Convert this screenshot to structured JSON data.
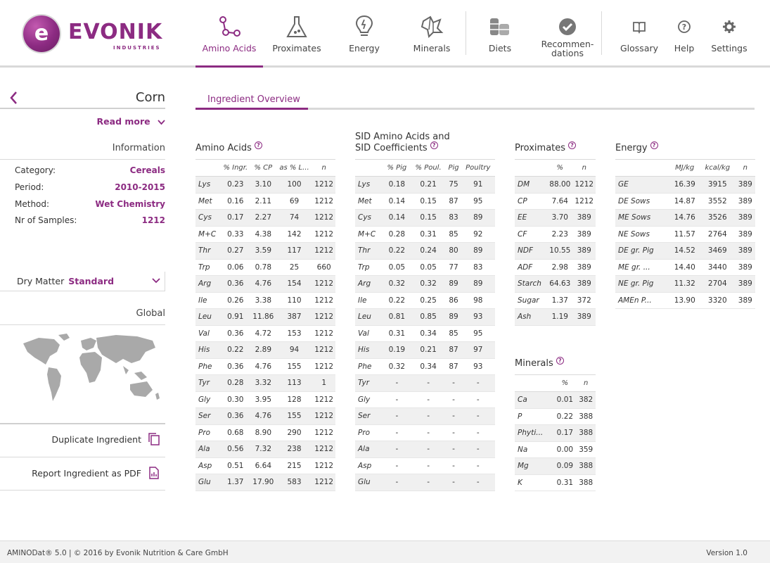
{
  "brand": {
    "name": "EVONIK",
    "sub": "INDUSTRIES"
  },
  "nav": [
    {
      "label": "Amino Acids",
      "icon": "molecule-icon",
      "active": true
    },
    {
      "label": "Proximates",
      "icon": "flask-icon"
    },
    {
      "label": "Energy",
      "icon": "lightbulb-icon"
    },
    {
      "label": "Minerals",
      "icon": "mineral-icon"
    },
    {
      "label": "Diets",
      "icon": "diets-icon"
    },
    {
      "label": "Recommen-\ndations",
      "icon": "check-badge-icon"
    },
    {
      "label": "Glossary",
      "icon": "book-icon"
    },
    {
      "label": "Help",
      "icon": "help-icon"
    },
    {
      "label": "Settings",
      "icon": "gear-icon"
    }
  ],
  "ingredient": {
    "name": "Corn",
    "read_more": "Read more",
    "information_label": "Information",
    "info": [
      {
        "key": "Category:",
        "value": "Cereals"
      },
      {
        "key": "Period:",
        "value": "2010-2015"
      },
      {
        "key": "Method:",
        "value": "Wet Chemistry"
      },
      {
        "key": "Nr of Samples:",
        "value": "1212"
      }
    ],
    "dry_matter_label": "Dry Matter",
    "dry_matter_value": "Standard",
    "global_label": "Global",
    "duplicate_label": "Duplicate Ingredient",
    "report_label": "Report Ingredient as PDF"
  },
  "tab": "Ingredient Overview",
  "amino_acids": {
    "title": "Amino Acids",
    "columns": [
      "",
      "% Ingr.",
      "% CP",
      "as % L...",
      "n"
    ],
    "rows": [
      [
        "Lys",
        "0.23",
        "3.10",
        "100",
        "1212"
      ],
      [
        "Met",
        "0.16",
        "2.11",
        "69",
        "1212"
      ],
      [
        "Cys",
        "0.17",
        "2.27",
        "74",
        "1212"
      ],
      [
        "M+C",
        "0.33",
        "4.38",
        "142",
        "1212"
      ],
      [
        "Thr",
        "0.27",
        "3.59",
        "117",
        "1212"
      ],
      [
        "Trp",
        "0.06",
        "0.78",
        "25",
        "660"
      ],
      [
        "Arg",
        "0.36",
        "4.76",
        "154",
        "1212"
      ],
      [
        "Ile",
        "0.26",
        "3.38",
        "110",
        "1212"
      ],
      [
        "Leu",
        "0.91",
        "11.86",
        "387",
        "1212"
      ],
      [
        "Val",
        "0.36",
        "4.72",
        "153",
        "1212"
      ],
      [
        "His",
        "0.22",
        "2.89",
        "94",
        "1212"
      ],
      [
        "Phe",
        "0.36",
        "4.76",
        "155",
        "1212"
      ],
      [
        "Tyr",
        "0.28",
        "3.32",
        "113",
        "1"
      ],
      [
        "Gly",
        "0.30",
        "3.95",
        "128",
        "1212"
      ],
      [
        "Ser",
        "0.36",
        "4.76",
        "155",
        "1212"
      ],
      [
        "Pro",
        "0.68",
        "8.90",
        "290",
        "1212"
      ],
      [
        "Ala",
        "0.56",
        "7.32",
        "238",
        "1212"
      ],
      [
        "Asp",
        "0.51",
        "6.64",
        "215",
        "1212"
      ],
      [
        "Glu",
        "1.37",
        "17.90",
        "583",
        "1212"
      ]
    ]
  },
  "sid": {
    "title_line1": "SID Amino Acids and",
    "title_line2": "SID Coefficients",
    "columns": [
      "",
      "% Pig",
      "% Poul.",
      "Pig",
      "Poultry"
    ],
    "rows": [
      [
        "Lys",
        "0.18",
        "0.21",
        "75",
        "91"
      ],
      [
        "Met",
        "0.14",
        "0.15",
        "87",
        "95"
      ],
      [
        "Cys",
        "0.14",
        "0.15",
        "83",
        "89"
      ],
      [
        "M+C",
        "0.28",
        "0.31",
        "85",
        "92"
      ],
      [
        "Thr",
        "0.22",
        "0.24",
        "80",
        "89"
      ],
      [
        "Trp",
        "0.05",
        "0.05",
        "77",
        "83"
      ],
      [
        "Arg",
        "0.32",
        "0.32",
        "89",
        "89"
      ],
      [
        "Ile",
        "0.22",
        "0.25",
        "86",
        "98"
      ],
      [
        "Leu",
        "0.81",
        "0.85",
        "89",
        "93"
      ],
      [
        "Val",
        "0.31",
        "0.34",
        "85",
        "95"
      ],
      [
        "His",
        "0.19",
        "0.21",
        "87",
        "97"
      ],
      [
        "Phe",
        "0.32",
        "0.34",
        "87",
        "93"
      ],
      [
        "Tyr",
        "-",
        "-",
        "-",
        "-"
      ],
      [
        "Gly",
        "-",
        "-",
        "-",
        "-"
      ],
      [
        "Ser",
        "-",
        "-",
        "-",
        "-"
      ],
      [
        "Pro",
        "-",
        "-",
        "-",
        "-"
      ],
      [
        "Ala",
        "-",
        "-",
        "-",
        "-"
      ],
      [
        "Asp",
        "-",
        "-",
        "-",
        "-"
      ],
      [
        "Glu",
        "-",
        "-",
        "-",
        "-"
      ]
    ]
  },
  "proximates": {
    "title": "Proximates",
    "columns": [
      "",
      "%",
      "n"
    ],
    "rows": [
      [
        "DM",
        "88.00",
        "1212"
      ],
      [
        "CP",
        "7.64",
        "1212"
      ],
      [
        "EE",
        "3.70",
        "389"
      ],
      [
        "CF",
        "2.23",
        "389"
      ],
      [
        "NDF",
        "10.55",
        "389"
      ],
      [
        "ADF",
        "2.98",
        "389"
      ],
      [
        "Starch",
        "64.63",
        "389"
      ],
      [
        "Sugar",
        "1.37",
        "372"
      ],
      [
        "Ash",
        "1.19",
        "389"
      ]
    ]
  },
  "minerals": {
    "title": "Minerals",
    "columns": [
      "",
      "%",
      "n"
    ],
    "rows": [
      [
        "Ca",
        "0.01",
        "382"
      ],
      [
        "P",
        "0.22",
        "388"
      ],
      [
        "Phyti...",
        "0.17",
        "388"
      ],
      [
        "Na",
        "0.00",
        "359"
      ],
      [
        "Mg",
        "0.09",
        "388"
      ],
      [
        "K",
        "0.31",
        "388"
      ]
    ]
  },
  "energy": {
    "title": "Energy",
    "columns": [
      "",
      "MJ/kg",
      "kcal/kg",
      "n"
    ],
    "rows": [
      [
        "GE",
        "16.39",
        "3915",
        "389"
      ],
      [
        "DE Sows",
        "14.87",
        "3552",
        "389"
      ],
      [
        "ME Sows",
        "14.76",
        "3526",
        "389"
      ],
      [
        "NE Sows",
        "11.57",
        "2764",
        "389"
      ],
      [
        "DE gr. Pig",
        "14.52",
        "3469",
        "389"
      ],
      [
        "ME gr. ...",
        "14.40",
        "3440",
        "389"
      ],
      [
        "NE gr. Pig",
        "11.32",
        "2704",
        "389"
      ],
      [
        "AMEn P...",
        "13.90",
        "3320",
        "389"
      ]
    ]
  },
  "footer": {
    "left": "AMINODat® 5.0 | © 2016 by Evonik Nutrition & Care GmbH",
    "right": "Version 1.0"
  },
  "colors": {
    "accent": "#8c2b82",
    "grid": "#d9d9d9",
    "stripe": "#f0f0f0"
  }
}
